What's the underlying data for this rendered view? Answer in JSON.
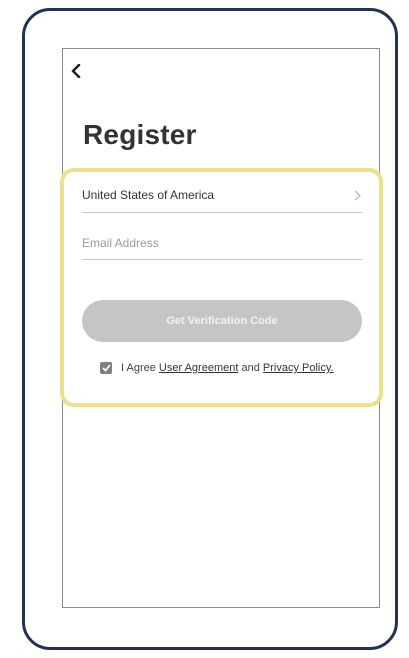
{
  "header": {
    "back_icon": "chevron-left-icon",
    "title": "Register"
  },
  "form": {
    "country": {
      "value": "United States of America",
      "icon": "chevron-right-icon"
    },
    "email": {
      "placeholder": "Email Address",
      "value": ""
    },
    "verify_button_label": "Get Verification Code",
    "agreement": {
      "checked": true,
      "prefix": "I Agree",
      "user_agreement_link": "User Agreement",
      "conjunction": "and",
      "privacy_policy_link": "Privacy Policy."
    }
  },
  "colors": {
    "frame_border": "#23324f",
    "highlight": "#eedf8c",
    "button_disabled": "#c5c5c5",
    "checkbox": "#7f7f84"
  }
}
